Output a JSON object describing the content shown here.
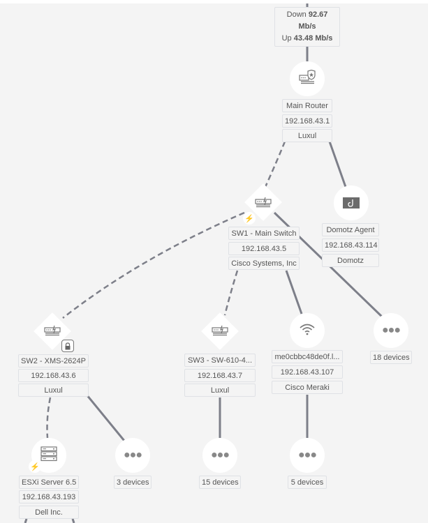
{
  "internet_link": {
    "down_label": "Down",
    "down_value": "92.67 Mb/s",
    "up_label": "Up",
    "up_value": "43.48 Mb/s"
  },
  "nodes": {
    "main_router": {
      "name": "Main Router",
      "ip": "192.168.43.1",
      "vendor": "Luxul",
      "icon": "router-shield-icon"
    },
    "domotz_agent": {
      "name": "Domotz Agent",
      "ip": "192.168.43.114",
      "vendor": "Domotz",
      "icon": "domotz-logo-icon"
    },
    "sw1": {
      "name": "SW1 - Main Switch",
      "ip": "192.168.43.5",
      "vendor": "Cisco Systems, Inc",
      "icon": "switch-icon"
    },
    "sw2": {
      "name": "SW2 - XMS-2624P",
      "ip": "192.168.43.6",
      "vendor": "Luxul",
      "icon": "switch-icon"
    },
    "sw3": {
      "name": "SW3 - SW-610-4...",
      "ip": "192.168.43.7",
      "vendor": "Luxul",
      "icon": "switch-icon"
    },
    "ap": {
      "name": "me0cbbc48de0f.l...",
      "ip": "192.168.43.107",
      "vendor": "Cisco Meraki",
      "icon": "wifi-icon"
    },
    "esxi": {
      "name": "ESXi Server 6.5",
      "ip": "192.168.43.193",
      "vendor": "Dell Inc.",
      "icon": "server-icon"
    }
  },
  "groups": {
    "sw1_group": {
      "label": "18 devices"
    },
    "sw2_group": {
      "label": "3 devices"
    },
    "sw3_group": {
      "label": "15 devices"
    },
    "ap_group": {
      "label": "5 devices"
    }
  },
  "colors": {
    "background": "#f4f4f4",
    "link": "#7d7f89",
    "label_border": "#dfe1e5",
    "text": "#555555"
  }
}
